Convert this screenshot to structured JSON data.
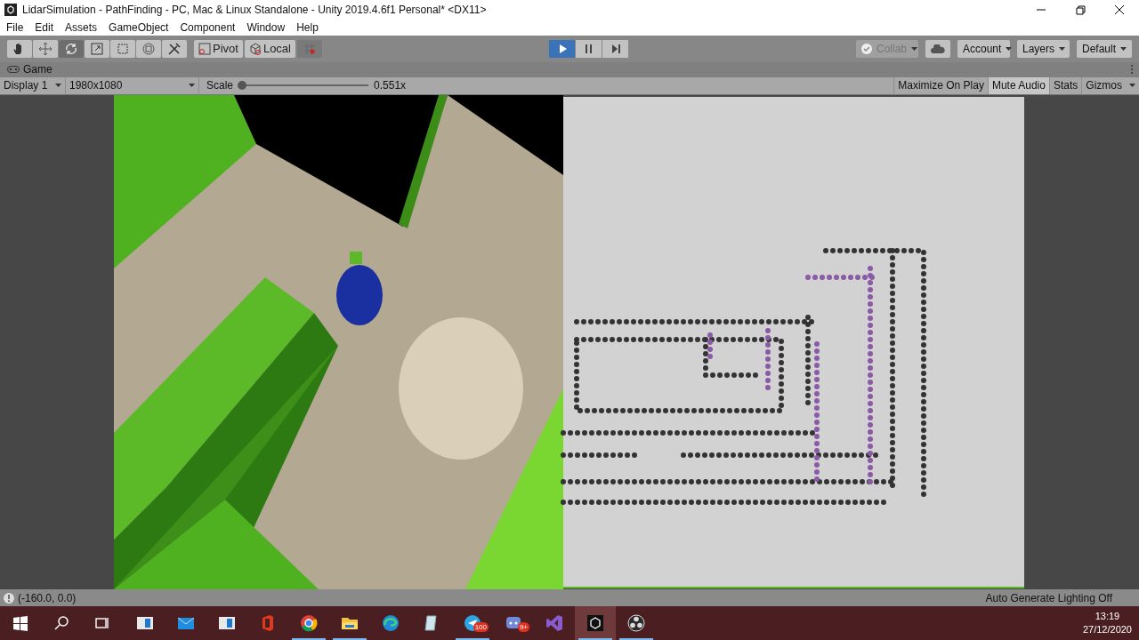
{
  "window": {
    "title": "LidarSimulation - PathFinding - PC, Mac & Linux Standalone - Unity 2019.4.6f1 Personal* <DX11>"
  },
  "menu": [
    "File",
    "Edit",
    "Assets",
    "GameObject",
    "Component",
    "Window",
    "Help"
  ],
  "tools": [
    {
      "kind": "hand",
      "selected": false
    },
    {
      "kind": "move",
      "selected": false
    },
    {
      "kind": "rotate",
      "selected": true
    },
    {
      "kind": "scale",
      "selected": false
    },
    {
      "kind": "rect",
      "selected": false
    },
    {
      "kind": "transform",
      "selected": false
    },
    {
      "kind": "custom",
      "selected": false
    }
  ],
  "handles": [
    {
      "kind": "pivot",
      "label": "Pivot"
    },
    {
      "kind": "local",
      "label": "Local"
    }
  ],
  "playback": [
    {
      "kind": "play",
      "selected": true
    },
    {
      "kind": "pause",
      "selected": false
    },
    {
      "kind": "step",
      "selected": false
    }
  ],
  "collab": {
    "label": "Collab",
    "disabled": true
  },
  "dropdowns": [
    "Account",
    "Layers",
    "Default"
  ],
  "game_tab": {
    "label": "Game"
  },
  "game_bar": {
    "display": "Display 1",
    "resolution": "1980x1080",
    "scale_label": "Scale",
    "scale": {
      "level": 0.03
    },
    "scale_reading": "0.551x",
    "toggles": [
      {
        "label": "Maximize On Play",
        "on": false
      },
      {
        "label": "Mute Audio",
        "on": true
      },
      {
        "label": "Stats",
        "on": false
      },
      {
        "label": "Gizmos",
        "on": false
      }
    ]
  },
  "status_bar": {
    "message": "(-160.0, 0.0)",
    "right": "Auto Generate Lighting Off"
  },
  "taskbar": {
    "items": [
      {
        "kind": "start",
        "running": false,
        "selected": false
      },
      {
        "kind": "search",
        "running": false,
        "selected": false
      },
      {
        "kind": "taskview",
        "running": false,
        "selected": false
      },
      {
        "kind": "window",
        "running": false,
        "selected": false
      },
      {
        "kind": "mail",
        "running": false,
        "selected": false
      },
      {
        "kind": "window",
        "running": false,
        "selected": false
      },
      {
        "kind": "office",
        "running": false,
        "selected": false
      },
      {
        "kind": "chrome",
        "running": true,
        "selected": false
      },
      {
        "kind": "folder",
        "running": true,
        "selected": false
      },
      {
        "kind": "edge",
        "running": false,
        "selected": false
      },
      {
        "kind": "notepad",
        "running": false,
        "selected": false
      },
      {
        "kind": "telegram",
        "running": true,
        "selected": false,
        "badge": "100"
      },
      {
        "kind": "discord",
        "running": false,
        "selected": false,
        "badge": "9+"
      },
      {
        "kind": "vs",
        "running": false,
        "selected": false
      },
      {
        "kind": "unity",
        "running": true,
        "selected": true
      },
      {
        "kind": "obs",
        "running": true,
        "selected": false
      }
    ],
    "time": "13:19",
    "date": "27/12/2020"
  }
}
